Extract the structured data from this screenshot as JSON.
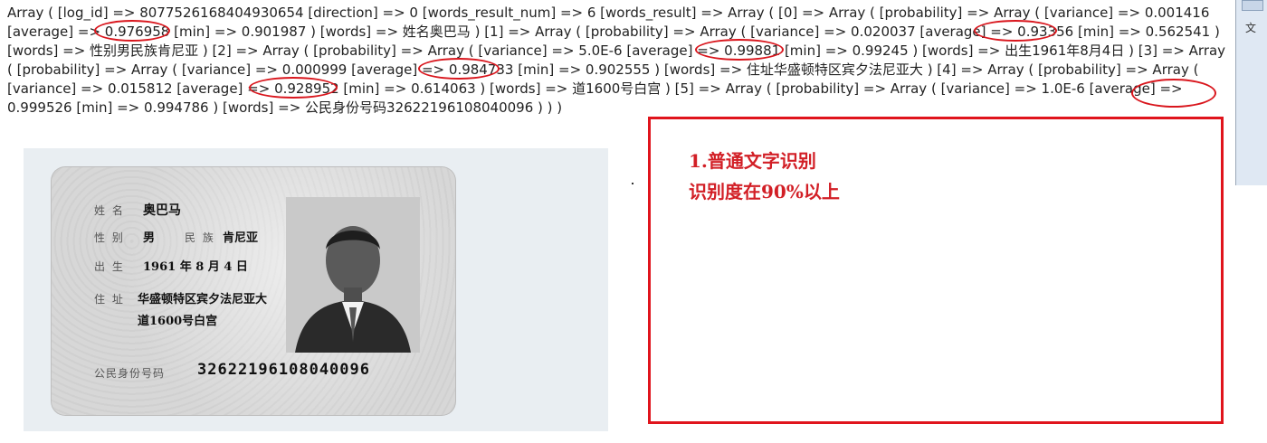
{
  "dump": {
    "text": "Array ( [log_id] => 8077526168404930654 [direction] => 0 [words_result_num] => 6 [words_result] => Array ( [0] => Array ( [probability] => Array ( [variance] => 0.001416 [average] => 0.976958 [min] => 0.901987 ) [words] => 姓名奥巴马 ) [1] => Array ( [probability] => Array ( [variance] => 0.020037 [average] => 0.93356 [min] => 0.562541 ) [words] => 性别男民族肯尼亚 ) [2] => Array ( [probability] => Array ( [variance] => 5.0E-6 [average] => 0.99881 [min] => 0.99245 ) [words] => 出生1961年8月4日 ) [3] => Array ( [probability] => Array ( [variance] => 0.000999 [average] => 0.984733 [min] => 0.902555 ) [words] => 住址华盛顿特区宾夕法尼亚大 ) [4] => Array ( [probability] => Array ( [variance] => 0.015812 [average] => 0.928952 [min] => 0.614063 ) [words] => 道1600号白宫 ) [5] => Array ( [probability] => Array ( [variance] => 1.0E-6 [average] => 0.999526 [min] => 0.994786 ) [words] => 公民身份号码32622196108040096 ) ) )"
  },
  "card": {
    "name_label": "姓 名",
    "name_value": "奥巴马",
    "gender_label": "性 别",
    "gender_value": "男",
    "ethnicity_label": "民 族",
    "ethnicity_value": "肯尼亚",
    "birth_label": "出 生",
    "birth_value": "1961 年 8 月 4 日",
    "address_label": "住 址",
    "address_line1": "华盛顿特区宾夕法尼亚大",
    "address_line2": "道1600号白宫",
    "id_label": "公民身份号码",
    "id_value": "32622196108040096"
  },
  "note": {
    "line1": "1.普通文字识别",
    "line2": "识别度在90%以上"
  },
  "window_edge": {
    "label": "文"
  },
  "colors": {
    "annotation_red": "#e0141c",
    "text": "#222222"
  }
}
